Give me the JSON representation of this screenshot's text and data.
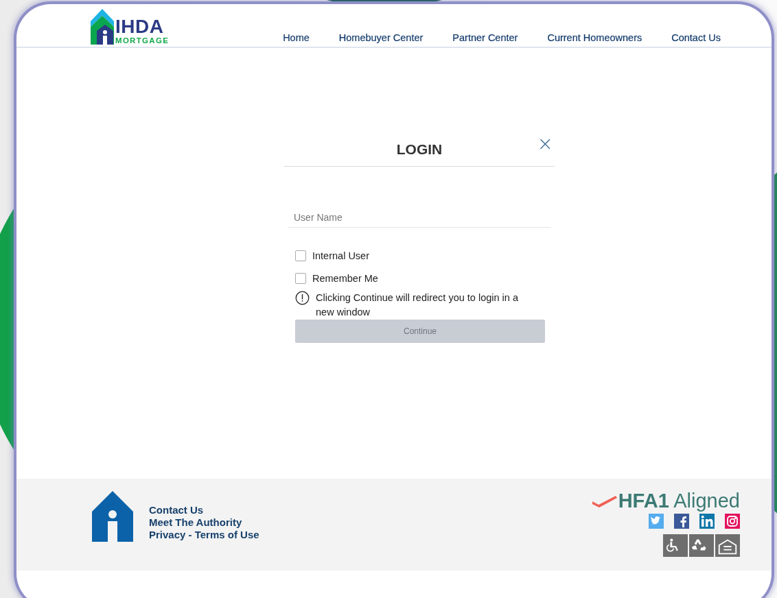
{
  "logo": {
    "name": "IHDA",
    "tagline": "MORTGAGE"
  },
  "nav": [
    "Home",
    "Homebuyer Center",
    "Partner Center",
    "Current Homeowners",
    "Contact Us"
  ],
  "login": {
    "title": "LOGIN",
    "close": "×",
    "username": {
      "placeholder": "User Name"
    },
    "options": [
      {
        "label": "Internal User",
        "checked": false
      },
      {
        "label": "Remember Me",
        "checked": false
      }
    ],
    "notice": "Clicking Continue will redirect you to login in a new window",
    "button": {
      "label": "Continue",
      "disabled": true
    }
  },
  "footer": {
    "links": [
      "Contact Us",
      "Meet The Authority",
      "Privacy - Terms of Use"
    ],
    "badge": {
      "strong": "HFA1",
      "rest": "Aligned"
    }
  }
}
